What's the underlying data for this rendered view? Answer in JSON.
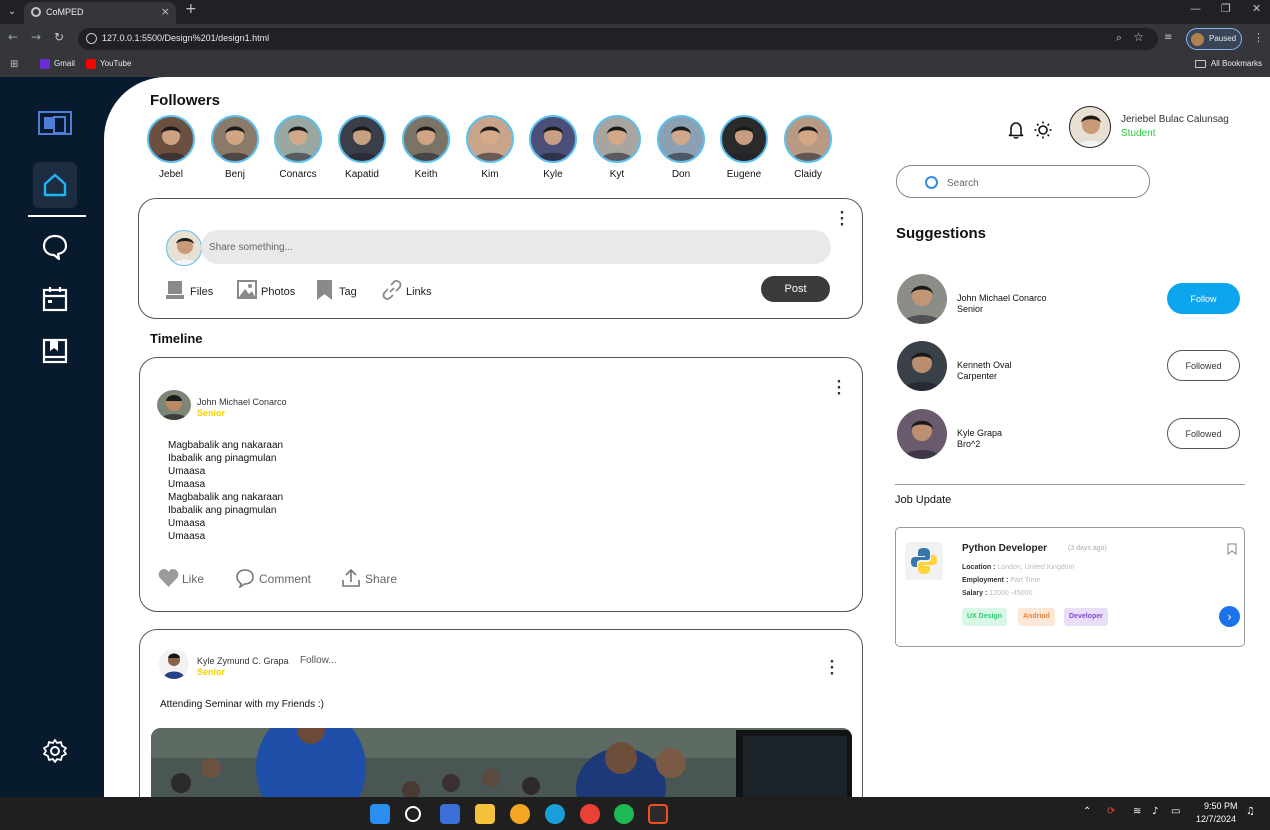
{
  "browser": {
    "tab_title": "CoMPED",
    "url": "127.0.0.1:5500/Design%201/design1.html",
    "profile_label": "Paused",
    "bookmarks": [
      {
        "label": "Gmail",
        "color": "#6c2bd9"
      },
      {
        "label": "YouTube",
        "color": "#ff0000"
      }
    ],
    "all_bookmarks_label": "All Bookmarks"
  },
  "followers": {
    "title": "Followers",
    "items": [
      {
        "name": "Jebel",
        "tone": "#6b5040"
      },
      {
        "name": "Benj",
        "tone": "#8a7a6a"
      },
      {
        "name": "Conarcs",
        "tone": "#9aa6a0"
      },
      {
        "name": "Kapatid",
        "tone": "#3a3e48"
      },
      {
        "name": "Keith",
        "tone": "#7a7466"
      },
      {
        "name": "Kim",
        "tone": "#c8a48a"
      },
      {
        "name": "Kyle",
        "tone": "#4a4e78"
      },
      {
        "name": "Kyt",
        "tone": "#a8a4a0"
      },
      {
        "name": "Don",
        "tone": "#8ca0b4"
      },
      {
        "name": "Eugene",
        "tone": "#2a2a2a"
      },
      {
        "name": "Claidy",
        "tone": "#b89a84"
      }
    ]
  },
  "composer": {
    "placeholder": "Share something...",
    "attachments": [
      "Files",
      "Photos",
      "Tag",
      "Links"
    ],
    "post_label": "Post"
  },
  "timeline": {
    "title": "Timeline",
    "posts": [
      {
        "author": "John Michael Conarco",
        "role": "Senior",
        "lines": [
          "Magbabalik ang nakaraan",
          "Ibabalik ang pinagmulan",
          "Umaasa",
          "Umaasa",
          "Magbabalik ang nakaraan",
          "Ibabalik ang pinagmulan",
          "Umaasa",
          "Umaasa"
        ],
        "actions": [
          "Like",
          "Comment",
          "Share"
        ]
      },
      {
        "author": "Kyle Zymund C. Grapa",
        "role": "Senior",
        "follow_label": "Follow...",
        "caption": "Attending Seminar with my Friends :)"
      }
    ]
  },
  "profile": {
    "name": "Jeriebel Bulac Calunsag",
    "role": "Student"
  },
  "search": {
    "placeholder": "Search"
  },
  "suggestions": {
    "title": "Suggestions",
    "items": [
      {
        "name": "John Michael Conarco",
        "sub": "Senior",
        "button": "Follow",
        "followed": false,
        "tone": "#8a8e86"
      },
      {
        "name": "Kenneth Oval",
        "sub": "Carpenter",
        "button": "Followed",
        "followed": true,
        "tone": "#3a4048"
      },
      {
        "name": "Kyle Grapa",
        "sub": "Bro^2",
        "button": "Followed",
        "followed": true,
        "tone": "#6a5a6e"
      }
    ]
  },
  "job_update": {
    "title": "Job Update",
    "job": {
      "name": "Python Developer",
      "age": "(3 days ago)",
      "location_label": "Location :",
      "location": "London, United Kingdom",
      "employment_label": "Employment :",
      "employment": "Part Time",
      "salary_label": "Salary :",
      "salary": "12000 -45000",
      "tags": [
        {
          "label": "UX Design",
          "color": "#2ecc71",
          "bg": "#d9f7e6"
        },
        {
          "label": "Andriod",
          "color": "#e8833a",
          "bg": "#fde8d8"
        },
        {
          "label": "Developer",
          "color": "#7b4fd0",
          "bg": "#e8def8"
        }
      ]
    }
  },
  "taskbar": {
    "time": "9:50 PM",
    "date": "12/7/2024"
  }
}
